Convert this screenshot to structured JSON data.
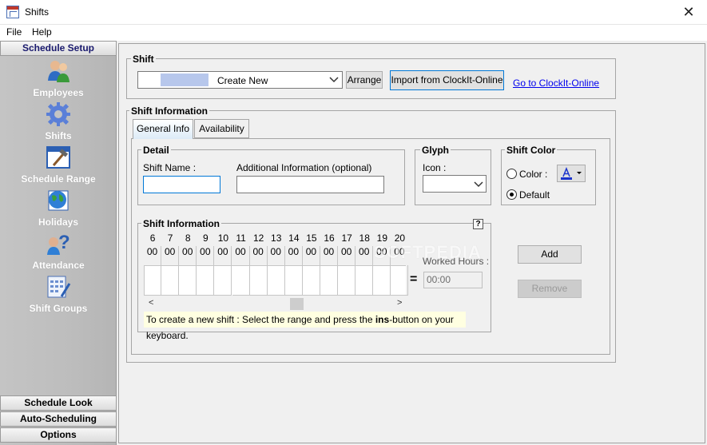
{
  "window": {
    "title": "Shifts",
    "close_glyph": "✕"
  },
  "menu": {
    "file": "File",
    "help": "Help"
  },
  "sidebar": {
    "header": "Schedule Setup",
    "items": [
      {
        "label": "Employees",
        "icon": "employees-icon"
      },
      {
        "label": "Shifts",
        "icon": "gear-icon"
      },
      {
        "label": "Schedule Range",
        "icon": "hammer-icon"
      },
      {
        "label": "Holidays",
        "icon": "globe-icon"
      },
      {
        "label": "Attendance",
        "icon": "question-person-icon"
      },
      {
        "label": "Shift Groups",
        "icon": "calculator-icon"
      }
    ],
    "bottom": [
      "Schedule Look",
      "Auto-Scheduling",
      "Options"
    ]
  },
  "shift": {
    "legend": "Shift",
    "combo_value": "Create New",
    "arrange": "Arrange",
    "import": "Import from ClockIt-Online",
    "goto": "Go to ClockIt-Online"
  },
  "shift_info": {
    "legend": "Shift Information",
    "tabs": [
      "General Info",
      "Availability"
    ],
    "detail": {
      "legend": "Detail",
      "shift_name_label": "Shift Name :",
      "shift_name_value": "",
      "additional_label": "Additional Information (optional)",
      "additional_value": ""
    },
    "glyph": {
      "legend": "Glyph",
      "icon_label": "Icon :"
    },
    "color": {
      "legend": "Shift Color",
      "color_option": "Color :",
      "default_option": "Default"
    },
    "grid": {
      "legend": "Shift Information",
      "help": "?",
      "hours": [
        "6",
        "7",
        "8",
        "9",
        "10",
        "11",
        "12",
        "13",
        "14",
        "15",
        "16",
        "17",
        "18",
        "19",
        "20"
      ],
      "minutes": "00",
      "hint_pre": "To create a new shift : Select the range and press the ",
      "hint_key": "ins",
      "hint_post": "-button on your keyboard."
    },
    "worked_hours_label": "Worked Hours :",
    "worked_hours_value": "00:00",
    "equals": "=",
    "add": "Add",
    "remove": "Remove"
  },
  "watermark": "SOFTPEDIA",
  "colors": {
    "link": "#0000ee",
    "accent": "#0078d7",
    "color_swatch": "#1a33cc"
  }
}
